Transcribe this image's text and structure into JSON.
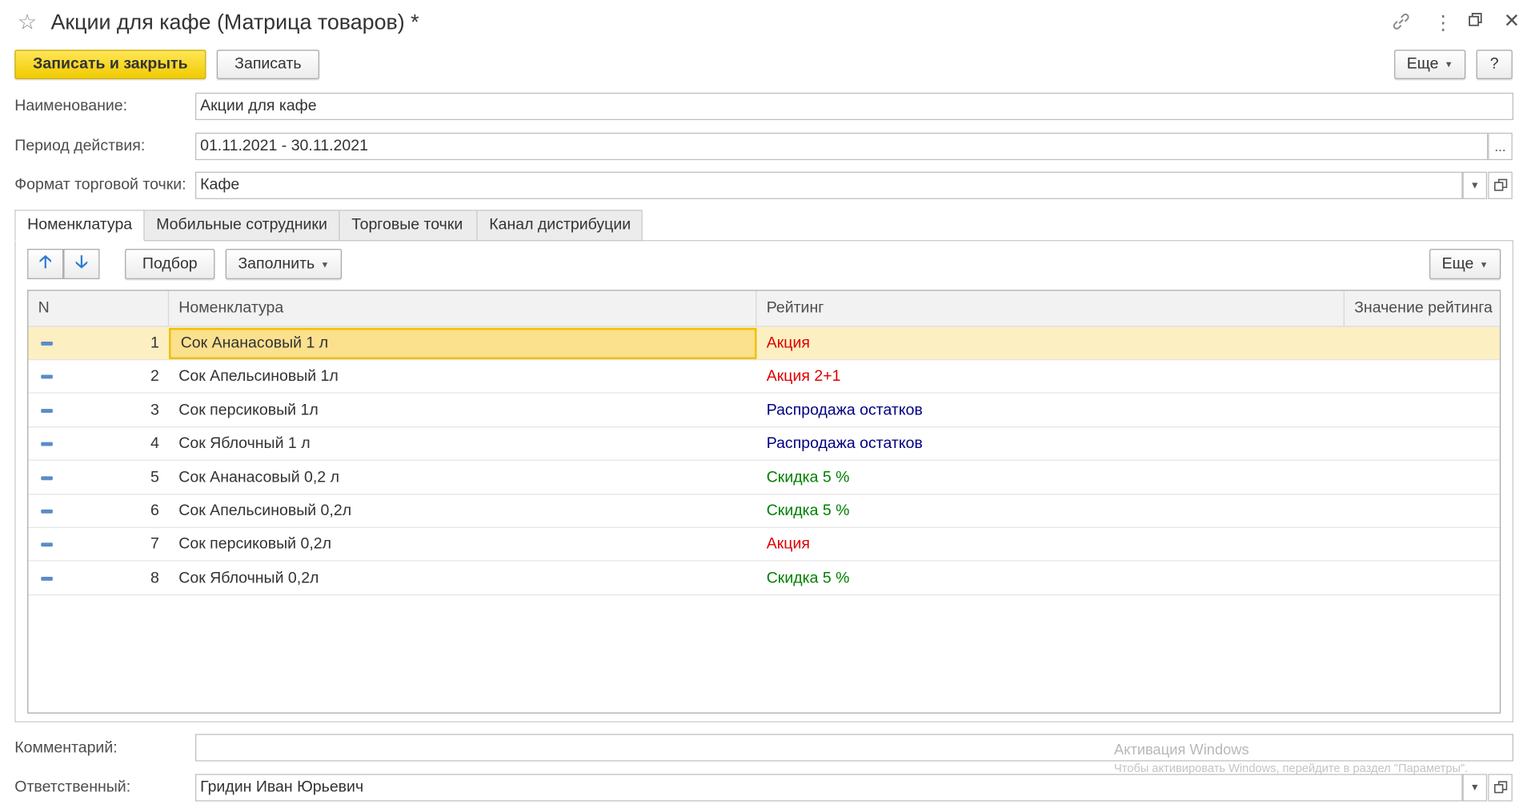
{
  "window": {
    "title": "Акции для кафе (Матрица товаров) *"
  },
  "toolbar": {
    "save_close_label": "Записать и закрыть",
    "save_label": "Записать",
    "more_label": "Еще",
    "help_label": "?"
  },
  "form": {
    "name_label": "Наименование:",
    "name_value": "Акции для кафе",
    "period_label": "Период действия:",
    "period_value": "01.11.2021 - 30.11.2021",
    "format_label": "Формат торговой точки:",
    "format_value": "Кафе",
    "comment_label": "Комментарий:",
    "comment_value": "",
    "responsible_label": "Ответственный:",
    "responsible_value": "Гридин Иван Юрьевич"
  },
  "tabs": [
    {
      "label": "Номенклатура",
      "active": true
    },
    {
      "label": "Мобильные сотрудники",
      "active": false
    },
    {
      "label": "Торговые точки",
      "active": false
    },
    {
      "label": "Канал дистрибуции",
      "active": false
    }
  ],
  "table_toolbar": {
    "pick_label": "Подбор",
    "fill_label": "Заполнить",
    "more_label": "Еще"
  },
  "table": {
    "columns": [
      "N",
      "Номенклатура",
      "Рейтинг",
      "Значение рейтинга"
    ],
    "rows": [
      {
        "n": "1",
        "name": "Сок Ананасовый 1 л",
        "rating": "Акция",
        "rating_color": "#e00000",
        "value": ""
      },
      {
        "n": "2",
        "name": "Сок Апельсиновый 1л",
        "rating": "Акция 2+1",
        "rating_color": "#e00000",
        "value": ""
      },
      {
        "n": "3",
        "name": "Сок персиковый 1л",
        "rating": "Распродажа остатков",
        "rating_color": "#000080",
        "value": ""
      },
      {
        "n": "4",
        "name": "Сок Яблочный 1 л",
        "rating": "Распродажа остатков",
        "rating_color": "#000080",
        "value": ""
      },
      {
        "n": "5",
        "name": "Сок Ананасовый 0,2 л",
        "rating": "Скидка 5 %",
        "rating_color": "#008000",
        "value": ""
      },
      {
        "n": "6",
        "name": "Сок Апельсиновый 0,2л",
        "rating": "Скидка 5 %",
        "rating_color": "#008000",
        "value": ""
      },
      {
        "n": "7",
        "name": "Сок персиковый 0,2л",
        "rating": "Акция",
        "rating_color": "#e00000",
        "value": ""
      },
      {
        "n": "8",
        "name": "Сок Яблочный 0,2л",
        "rating": "Скидка 5 %",
        "rating_color": "#008000",
        "value": ""
      }
    ]
  },
  "watermark": {
    "line1": "Активация Windows",
    "line2": "Чтобы активировать Windows, перейдите в раздел \"Параметры\"."
  },
  "colors": {
    "primary_button": "#f5d317",
    "selected_row": "#fcefc2",
    "link_icon": "#2a7ad5"
  },
  "icons": [
    "star-icon",
    "link-icon",
    "kebab-menu-icon",
    "restore-window-icon",
    "close-icon",
    "arrow-up-icon",
    "arrow-down-icon",
    "row-marker-icon",
    "dropdown-arrow-icon",
    "open-form-icon",
    "ellipsis-icon"
  ]
}
